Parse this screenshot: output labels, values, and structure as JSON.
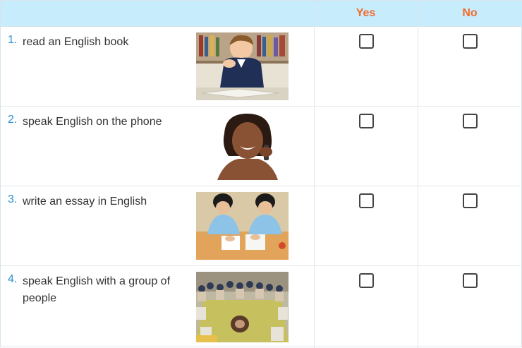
{
  "columns": {
    "yes": "Yes",
    "no": "No"
  },
  "rows": [
    {
      "number": "1.",
      "text": "read an English book",
      "image": "boy-reading-book",
      "yes": false,
      "no": false
    },
    {
      "number": "2.",
      "text": "speak English on the phone",
      "image": "woman-on-phone",
      "yes": false,
      "no": false
    },
    {
      "number": "3.",
      "text": "write an essay in English",
      "image": "students-writing",
      "yes": false,
      "no": false
    },
    {
      "number": "4.",
      "text": "speak English with a group of people",
      "image": "group-in-circle",
      "yes": false,
      "no": false
    }
  ],
  "colors": {
    "header_bg": "#c7ecfb",
    "header_text": "#f26b2a",
    "number_text": "#2a8fd2"
  }
}
